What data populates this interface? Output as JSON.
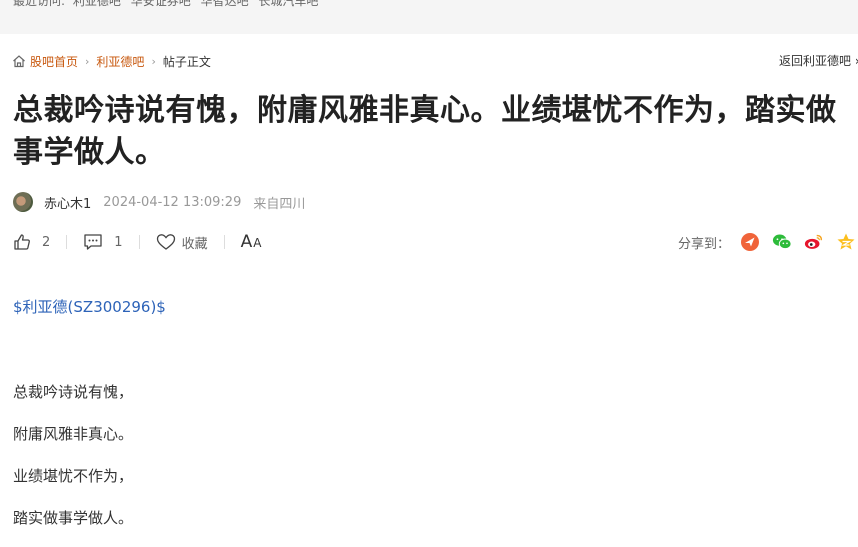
{
  "recent": {
    "label": "最近访问:",
    "items": [
      "利亚德吧",
      "华安证券吧",
      "华智达吧",
      "长城汽车吧"
    ]
  },
  "breadcrumb": {
    "home": "股吧首页",
    "bar": "利亚德吧",
    "current": "帖子正文",
    "separator": "›",
    "back": "返回利亚德吧 ›"
  },
  "post": {
    "title": "总裁吟诗说有愧，附庸风雅非真心。业绩堪忧不作为，踏实做事学做人。",
    "author": "赤心木1",
    "time": "2024-04-12 13:09:29",
    "location": "来自四川",
    "stock_tag": "$利亚德(SZ300296)$",
    "lines": [
      "总裁吟诗说有愧，",
      "附庸风雅非真心。",
      "业绩堪忧不作为，",
      "踏实做事学做人。"
    ]
  },
  "actions": {
    "likes": "2",
    "comments": "1",
    "favorite": "收藏",
    "font_big": "A",
    "font_small": "A"
  },
  "share": {
    "label": "分享到：",
    "icons": [
      "eastmoney-share-icon",
      "wechat-icon",
      "weibo-icon",
      "qq-zone-icon"
    ]
  },
  "colors": {
    "link_orange": "#c8580e",
    "stock_blue": "#2d63b8",
    "title": "#222222"
  }
}
